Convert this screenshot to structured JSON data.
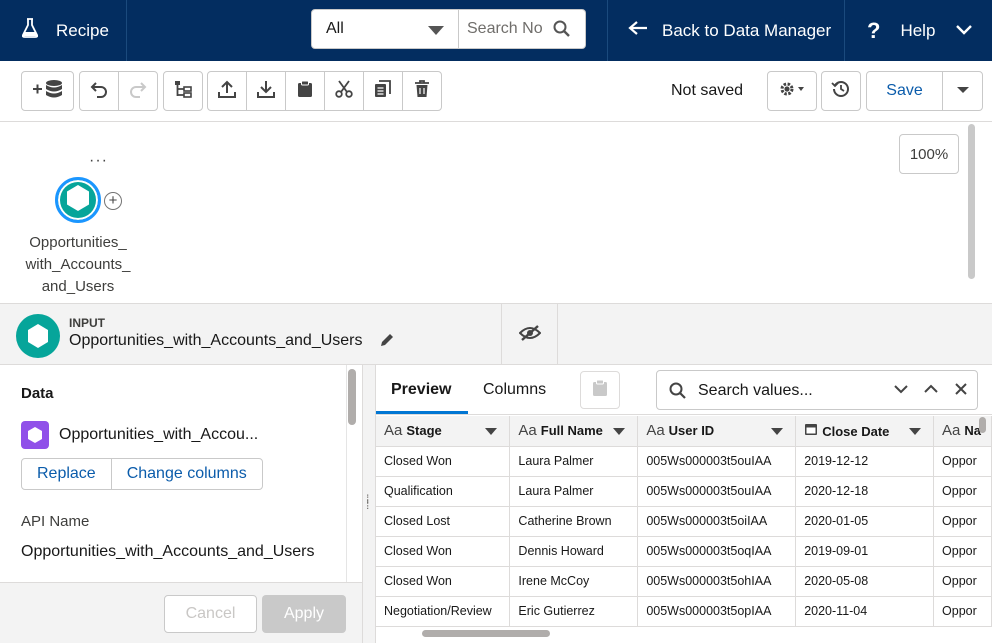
{
  "topbar": {
    "app_label": "Recipe",
    "search_scope": "All",
    "search_placeholder": "Search No",
    "back_label": "Back to Data Manager",
    "help_label": "Help"
  },
  "toolbar": {
    "status": "Not saved",
    "save_label": "Save"
  },
  "canvas": {
    "zoom": "100%",
    "node_menu": "···",
    "node_label": "Opportunities_ with_Accounts_ and_Users"
  },
  "panel": {
    "type_label": "INPUT",
    "node_name": "Opportunities_with_Accounts_and_Users"
  },
  "left": {
    "heading": "Data",
    "dataset_name": "Opportunities_with_Accou...",
    "replace_label": "Replace",
    "change_columns_label": "Change columns",
    "api_name_label": "API Name",
    "api_name_value": "Opportunities_with_Accounts_and_Users",
    "cancel_label": "Cancel",
    "apply_label": "Apply"
  },
  "right": {
    "tabs": [
      "Preview",
      "Columns"
    ],
    "search_placeholder": "Search values...",
    "type_glyph": "Aa",
    "columns": [
      "Stage",
      "Full Name",
      "User ID",
      "Close Date",
      "Na"
    ],
    "rows": [
      [
        "Closed Won",
        "Laura Palmer",
        "005Ws000003t5ouIAA",
        "2019-12-12",
        "Oppor"
      ],
      [
        "Qualification",
        "Laura Palmer",
        "005Ws000003t5ouIAA",
        "2020-12-18",
        "Oppor"
      ],
      [
        "Closed Lost",
        "Catherine Brown",
        "005Ws000003t5oiIAA",
        "2020-01-05",
        "Oppor"
      ],
      [
        "Closed Won",
        "Dennis Howard",
        "005Ws000003t5oqIAA",
        "2019-09-01",
        "Oppor"
      ],
      [
        "Closed Won",
        "Irene McCoy",
        "005Ws000003t5ohIAA",
        "2020-05-08",
        "Oppor"
      ],
      [
        "Negotiation/Review",
        "Eric Gutierrez",
        "005Ws000003t5opIAA",
        "2020-11-04",
        "Oppor"
      ]
    ]
  },
  "colors": {
    "topbar": "#032d60",
    "accent": "#0176d3",
    "node": "#06a59a",
    "dataset_icon": "#9050e9"
  }
}
